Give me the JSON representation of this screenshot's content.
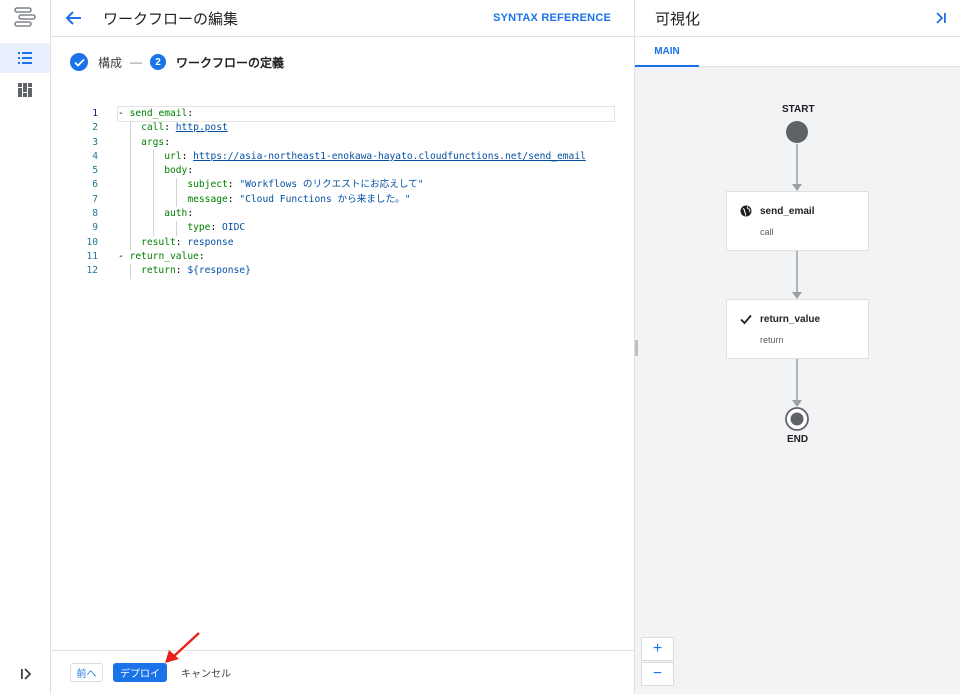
{
  "rail": {
    "logo": "workflows-logo-icon",
    "items": [
      {
        "icon": "list-icon",
        "active": true
      },
      {
        "icon": "dashboard-icon",
        "active": false
      }
    ],
    "expand_icon": "expand-right-icon"
  },
  "editor": {
    "header": {
      "back_icon": "arrow-back-icon",
      "title": "ワークフローの編集",
      "syntax_reference": "SYNTAX REFERENCE"
    },
    "stepper": {
      "step1_label": "構成",
      "separator": "—",
      "step2_number": "2",
      "step2_label": "ワークフローの定義"
    },
    "code_lines": [
      {
        "n": "1",
        "text": "- send_email:"
      },
      {
        "n": "2",
        "text": "call: http.post"
      },
      {
        "n": "3",
        "text": "args:"
      },
      {
        "n": "4",
        "text": "url: https://asia-northeast1-enokawa-hayato.cloudfunctions.net/send_email"
      },
      {
        "n": "5",
        "text": "body:"
      },
      {
        "n": "6",
        "text": "subject: \"Workflows のリクエストにお応えして\""
      },
      {
        "n": "7",
        "text": "message: \"Cloud Functions から来ました。\""
      },
      {
        "n": "8",
        "text": "auth:"
      },
      {
        "n": "9",
        "text": "type: OIDC"
      },
      {
        "n": "10",
        "text": "result: response"
      },
      {
        "n": "11",
        "text": "- return_value:"
      },
      {
        "n": "12",
        "text": "return: ${response}"
      }
    ],
    "footer": {
      "prev": "前へ",
      "deploy": "デプロイ",
      "cancel": "キャンセル"
    }
  },
  "viz": {
    "title": "可視化",
    "collapse_icon": "collapse-panel-icon",
    "tab_main": "MAIN",
    "start_label": "START",
    "end_label": "END",
    "steps": [
      {
        "name": "send_email",
        "type": "call",
        "icon": "globe-icon"
      },
      {
        "name": "return_value",
        "type": "return",
        "icon": "check-icon"
      }
    ],
    "zoom_in": "+",
    "zoom_out": "−"
  },
  "colors": {
    "accent": "#1a73e8",
    "annotation_arrow": "#e8221b",
    "node": "#5f6368"
  }
}
